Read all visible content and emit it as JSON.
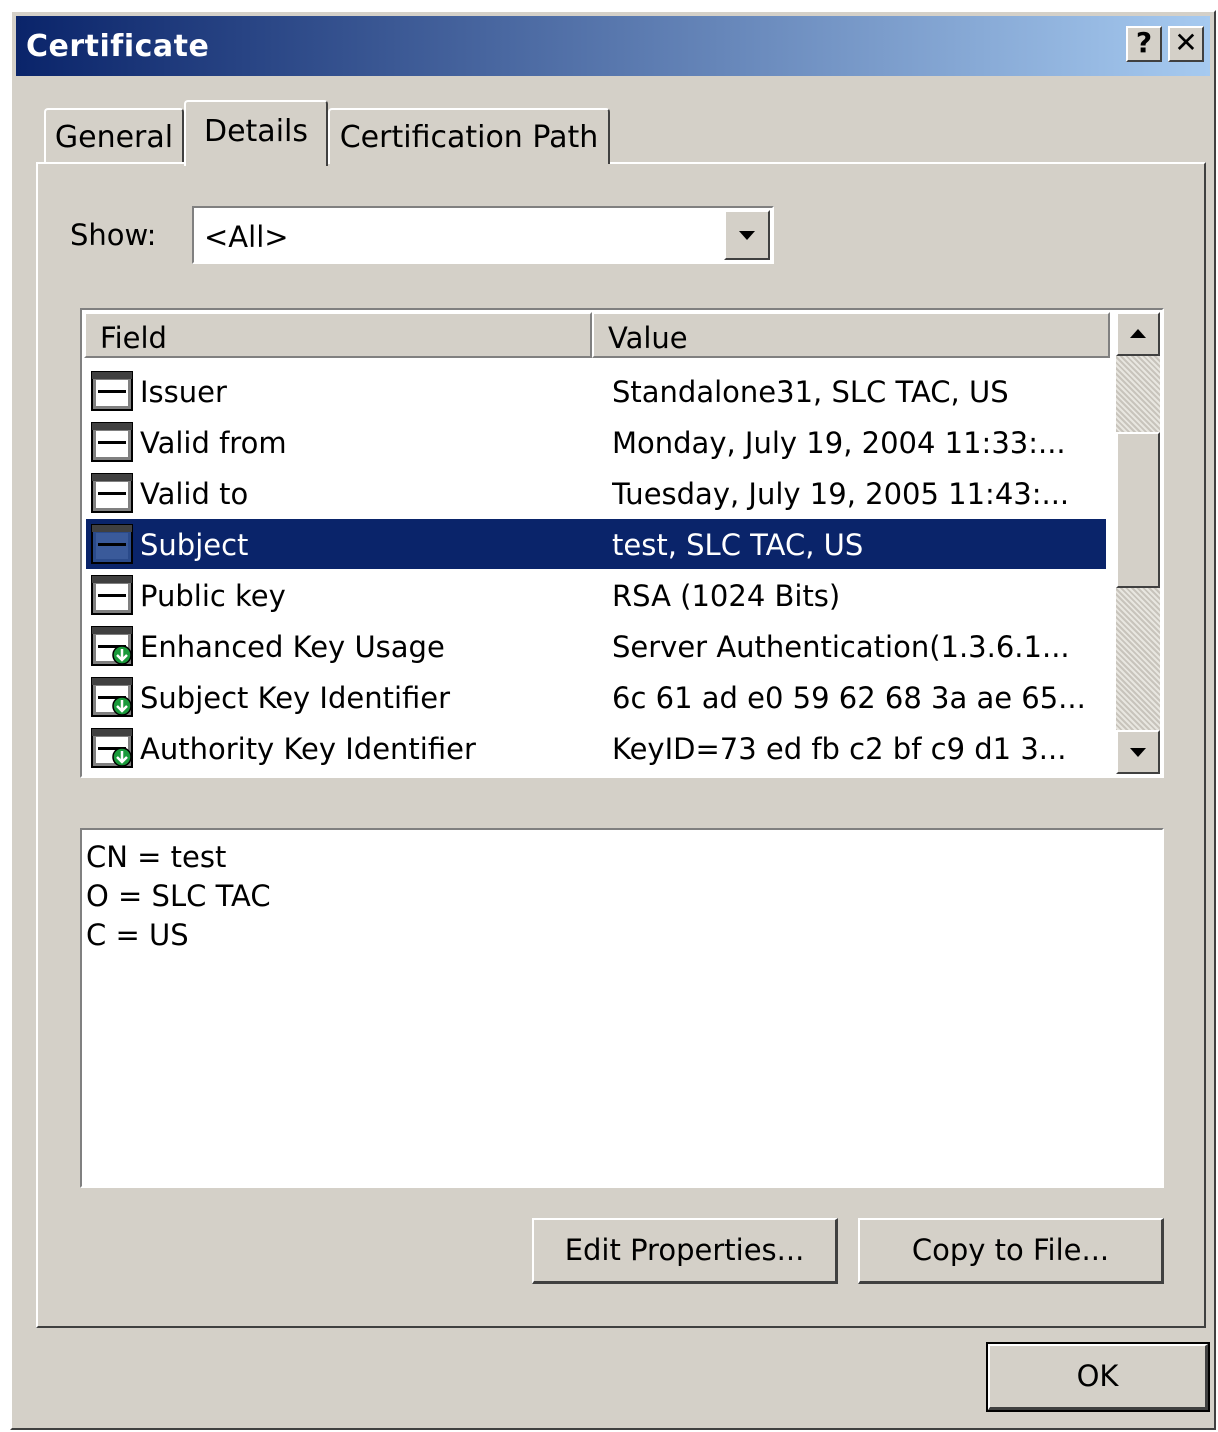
{
  "window": {
    "title": "Certificate",
    "help_label": "?",
    "close_label": "✕"
  },
  "tabs": [
    {
      "label": "General",
      "active": false
    },
    {
      "label": "Details",
      "active": true
    },
    {
      "label": "Certification Path",
      "active": false
    }
  ],
  "show": {
    "label": "Show:",
    "value": "<All>"
  },
  "list": {
    "columns": [
      "Field",
      "Value"
    ],
    "rows": [
      {
        "field": "Issuer",
        "value": "Standalone31, SLC TAC, US",
        "icon": "certificate-field-icon",
        "selected": false
      },
      {
        "field": "Valid from",
        "value": "Monday, July 19, 2004 11:33:...",
        "icon": "certificate-field-icon",
        "selected": false
      },
      {
        "field": "Valid to",
        "value": "Tuesday, July 19, 2005 11:43:...",
        "icon": "certificate-field-icon",
        "selected": false
      },
      {
        "field": "Subject",
        "value": "test, SLC TAC, US",
        "icon": "certificate-field-icon",
        "selected": true
      },
      {
        "field": "Public key",
        "value": "RSA (1024 Bits)",
        "icon": "certificate-field-icon",
        "selected": false
      },
      {
        "field": "Enhanced Key Usage",
        "value": "Server Authentication(1.3.6.1...",
        "icon": "certificate-extension-icon",
        "selected": false
      },
      {
        "field": "Subject Key Identifier",
        "value": "6c 61 ad e0 59 62 68 3a ae 65...",
        "icon": "certificate-extension-icon",
        "selected": false
      },
      {
        "field": "Authority Key Identifier",
        "value": "KeyID=73 ed fb c2 bf c9 d1 3...",
        "icon": "certificate-extension-icon",
        "selected": false
      }
    ]
  },
  "detail": {
    "lines": [
      "CN = test",
      "O = SLC TAC",
      "C = US"
    ]
  },
  "buttons": {
    "edit_properties": "Edit Properties...",
    "copy_to_file": "Copy to File...",
    "ok": "OK"
  },
  "colors": {
    "title_start": "#0a246a",
    "title_end": "#a6caf0",
    "selection": "#0a246a",
    "face": "#d4d0c8"
  }
}
